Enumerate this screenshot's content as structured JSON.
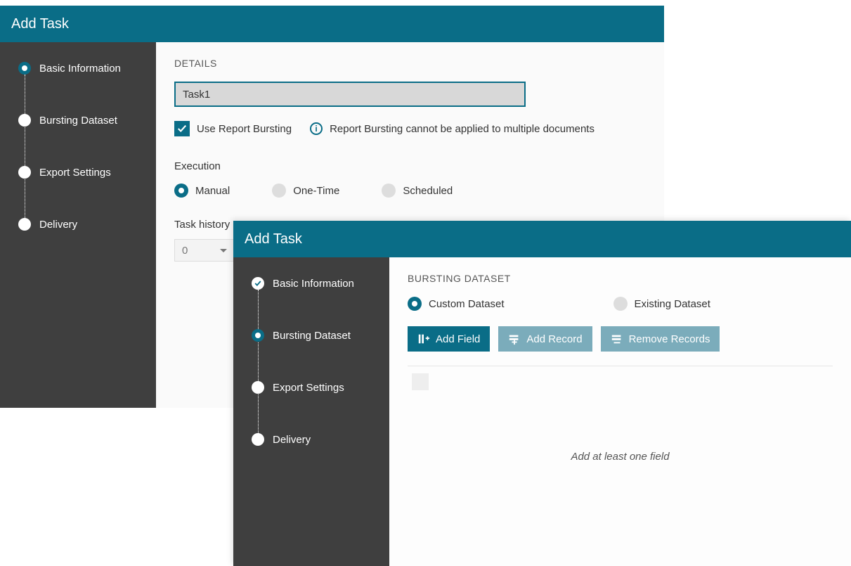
{
  "window1": {
    "title": "Add Task",
    "wizard": [
      {
        "label": "Basic Information",
        "state": "active"
      },
      {
        "label": "Bursting Dataset",
        "state": "pending"
      },
      {
        "label": "Export Settings",
        "state": "pending"
      },
      {
        "label": "Delivery",
        "state": "pending"
      }
    ],
    "section_heading": "DETAILS",
    "task_name_value": "Task1",
    "use_bursting_label": "Use Report Bursting",
    "use_bursting_checked": true,
    "bursting_info_text": "Report Bursting cannot be applied to multiple documents",
    "execution_heading": "Execution",
    "execution_options": [
      {
        "label": "Manual",
        "selected": true
      },
      {
        "label": "One-Time",
        "selected": false
      },
      {
        "label": "Scheduled",
        "selected": false
      }
    ],
    "history_label_partial": "Task history ex",
    "history_value": "0"
  },
  "window2": {
    "title": "Add Task",
    "wizard": [
      {
        "label": "Basic Information",
        "state": "done"
      },
      {
        "label": "Bursting Dataset",
        "state": "active"
      },
      {
        "label": "Export Settings",
        "state": "pending"
      },
      {
        "label": "Delivery",
        "state": "pending"
      }
    ],
    "section_heading": "BURSTING DATASET",
    "dataset_options": [
      {
        "label": "Custom Dataset",
        "selected": true
      },
      {
        "label": "Existing Dataset",
        "selected": false
      }
    ],
    "buttons": {
      "add_field": "Add Field",
      "add_record": "Add Record",
      "remove_records": "Remove Records"
    },
    "grid_hint": "Add at least one field"
  }
}
